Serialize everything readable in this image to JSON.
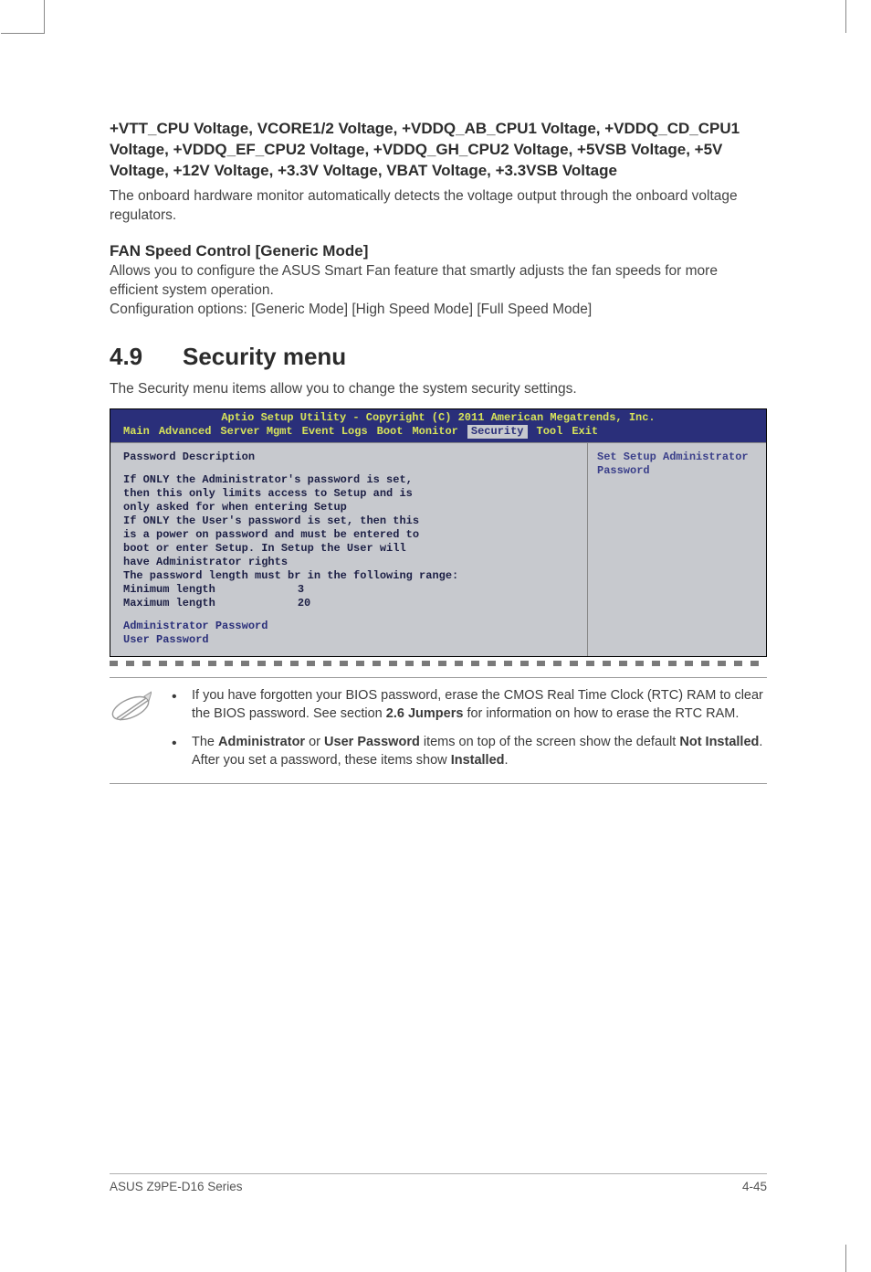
{
  "section1": {
    "heading": "+VTT_CPU Voltage, VCORE1/2 Voltage, +VDDQ_AB_CPU1 Voltage, +VDDQ_CD_CPU1 Voltage, +VDDQ_EF_CPU2 Voltage, +VDDQ_GH_CPU2 Voltage, +5VSB Voltage, +5V Voltage, +12V Voltage, +3.3V Voltage, VBAT Voltage, +3.3VSB Voltage",
    "body": "The onboard hardware monitor automatically detects the voltage output through the onboard voltage regulators."
  },
  "section2": {
    "heading": "FAN Speed Control [Generic Mode]",
    "body1": "Allows you to configure the ASUS Smart Fan feature that smartly adjusts the fan speeds for more efficient system operation.",
    "body2": "Configuration options: [Generic Mode] [High Speed Mode] [Full Speed Mode]"
  },
  "chapter": {
    "num": "4.9",
    "title": "Security menu",
    "intro": "The Security menu items allow you to change the system security settings."
  },
  "bios": {
    "title": "Aptio Setup Utility - Copyright (C) 2011 American Megatrends, Inc.",
    "tabs": [
      "Main",
      "Advanced",
      "Server Mgmt",
      "Event Logs",
      "Boot",
      "Monitor",
      "Security",
      "Tool",
      "Exit"
    ],
    "active_tab_index": 6,
    "left_heading": "Password Description",
    "left_lines": [
      "If ONLY the Administrator's password is set,",
      "then this only limits access to Setup and is",
      "only asked for when entering Setup",
      "If ONLY the User's password is set, then this",
      "is a power on password and must be entered to",
      "boot or enter Setup. In Setup the User will",
      "have Administrator rights",
      "The password length must br in the following range:"
    ],
    "min_label": "Minimum length",
    "min_val": "3",
    "max_label": "Maximum length",
    "max_val": "20",
    "admin_pw": "Administrator Password",
    "user_pw": "User Password",
    "right1": "Set Setup Administrator",
    "right2": "Password"
  },
  "notes": {
    "item1_a": "If you have forgotten your BIOS password, erase the CMOS Real Time Clock (RTC) RAM to clear the BIOS password. See section ",
    "item1_b": "2.6 Jumpers",
    "item1_c": " for information on how to erase the RTC RAM.",
    "item2_a": "The ",
    "item2_b": "Administrator",
    "item2_c": " or ",
    "item2_d": "User Password",
    "item2_e": " items on top of the screen show the default ",
    "item2_f": "Not Installed",
    "item2_g": ". After you set a password, these items show ",
    "item2_h": "Installed",
    "item2_i": "."
  },
  "footer": {
    "left": "ASUS Z9PE-D16 Series",
    "right": "4-45"
  }
}
